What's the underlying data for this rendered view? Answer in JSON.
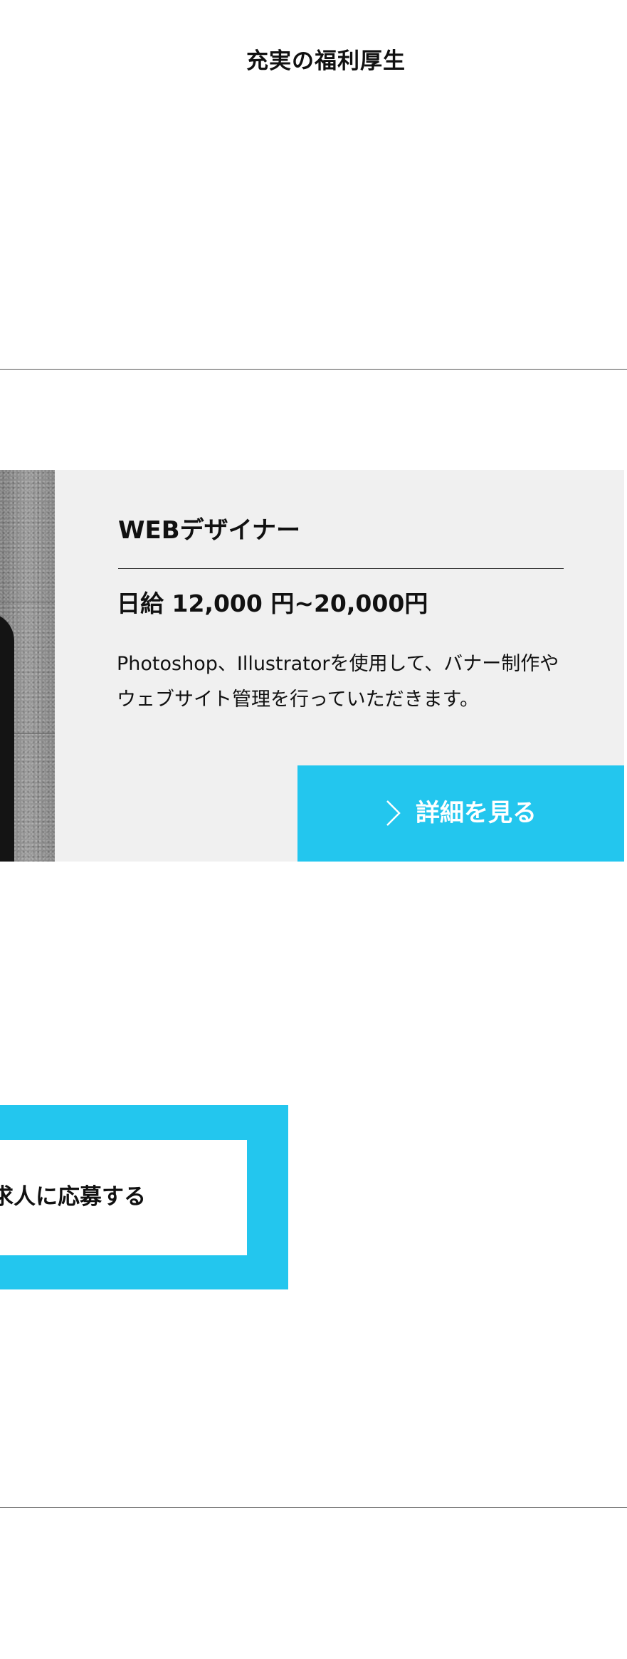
{
  "benefits": {
    "title": "充実の福利厚生"
  },
  "job": {
    "title": "WEBデザイナー",
    "salary": "日給 12,000 円~20,000円",
    "description_line1": "Photoshop、Illustratorを使用して、バナー制作や",
    "description_line2": "ウェブサイト管理を行っていただきます。",
    "detail_button_label": "詳細を見る",
    "detail_button_icon": "chevron-right-icon"
  },
  "apply": {
    "label": "求人に応募する"
  },
  "colors": {
    "accent": "#23c6ee",
    "card_background": "#f0f0f0",
    "text": "#111111"
  }
}
